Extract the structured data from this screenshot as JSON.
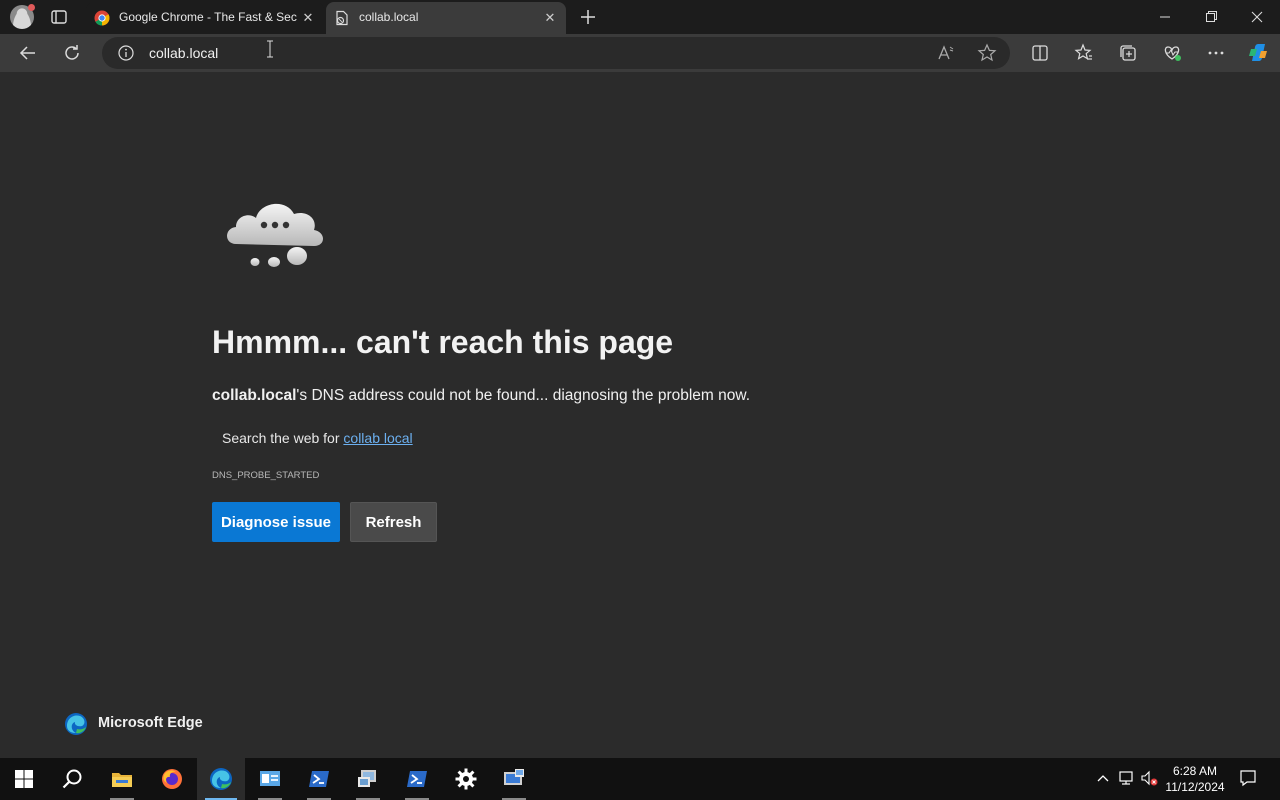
{
  "browser": {
    "tabs": [
      {
        "title": "Google Chrome - The Fast & Secure Web Browser",
        "active": false
      },
      {
        "title": "collab.local",
        "active": true
      }
    ],
    "address_bar": {
      "url": "collab.local"
    }
  },
  "error_page": {
    "headline": "Hmmm... can't reach this page",
    "host": "collab.local",
    "description_suffix": "'s DNS address could not be found... diagnosing the problem now.",
    "search_prefix": "Search the web for ",
    "search_link": "collab local",
    "error_code": "DNS_PROBE_STARTED",
    "primary_button": "Diagnose issue",
    "secondary_button": "Refresh",
    "brand": "Microsoft Edge"
  },
  "taskbar": {
    "apps": [
      "start-icon",
      "search-icon",
      "file-explorer-icon",
      "firefox-icon",
      "edge-icon",
      "server-manager-icon",
      "powershell-icon",
      "network-icon",
      "powershell-ise-icon",
      "settings-icon",
      "remote-desktop-icon"
    ],
    "clock": {
      "time": "6:28 AM",
      "date": "11/12/2024"
    }
  },
  "colors": {
    "accent": "#0a78d4",
    "link": "#6cb0f0",
    "page_bg": "#2b2b2b"
  }
}
